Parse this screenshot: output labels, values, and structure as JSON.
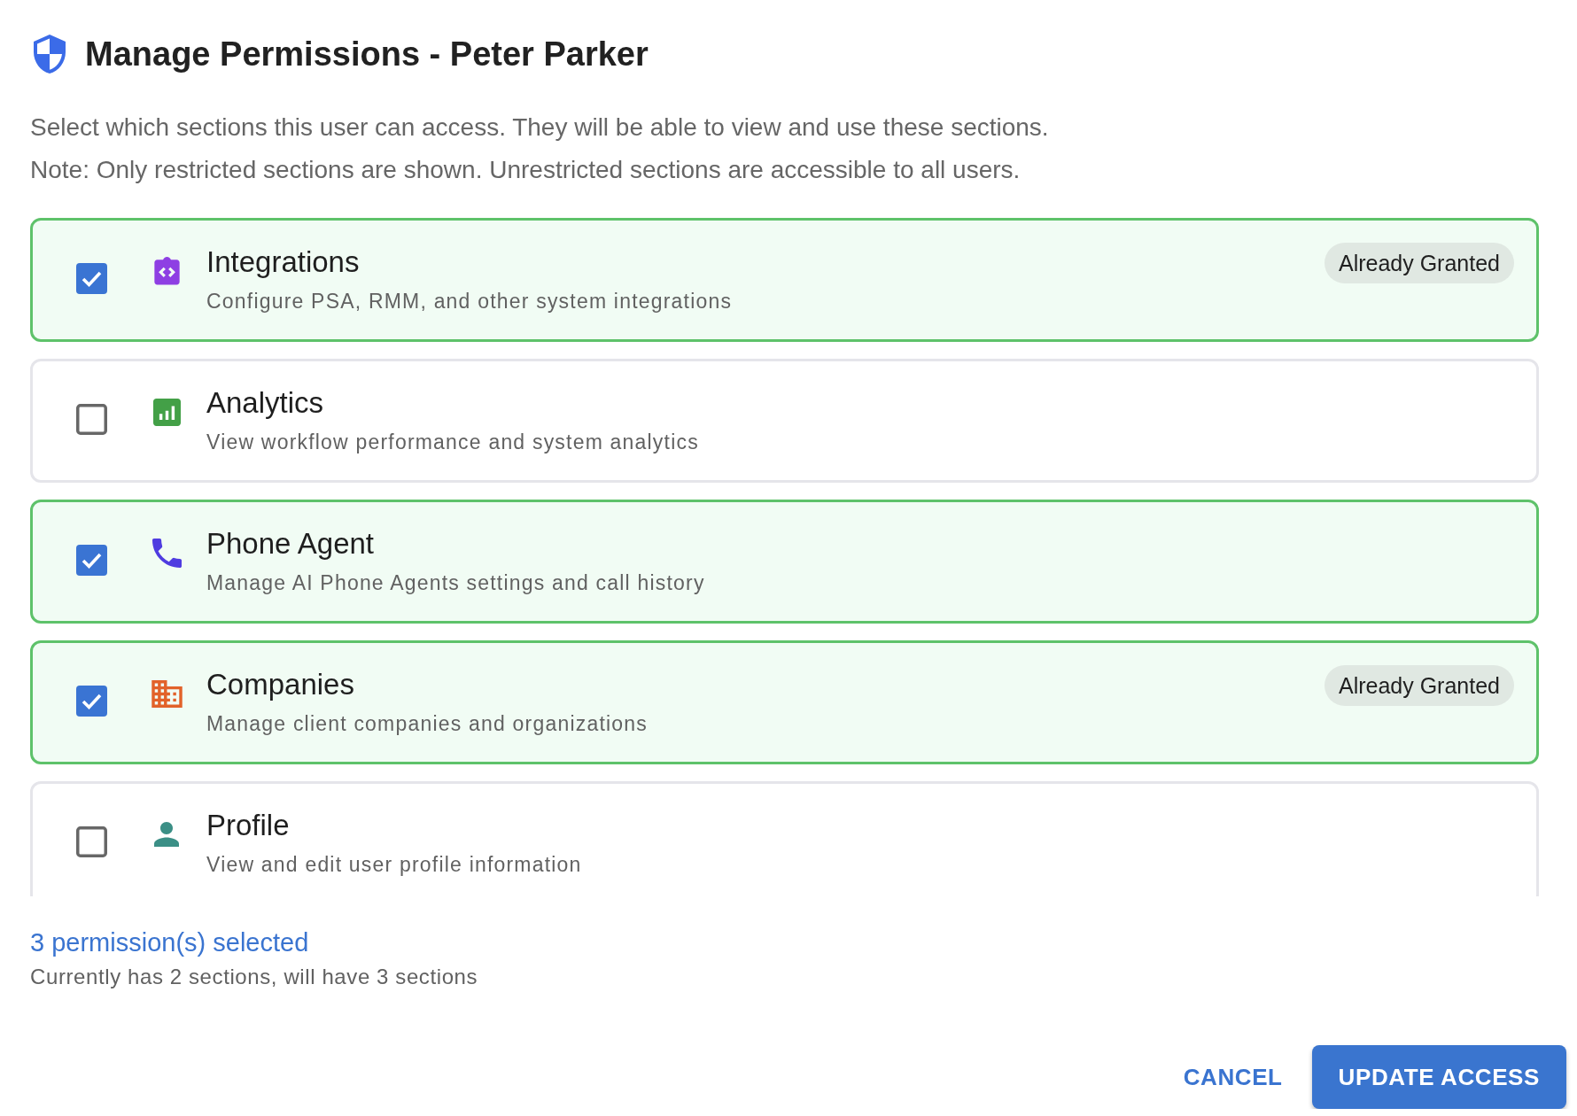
{
  "dialog": {
    "title": "Manage Permissions - Peter Parker",
    "description": [
      "Select which sections this user can access. They will be able to view and use these sections.",
      "Note: Only restricted sections are shown. Unrestricted sections are accessible to all users."
    ]
  },
  "sections": [
    {
      "name": "Integrations",
      "description": "Configure PSA, RMM, and other system integrations",
      "checked": true,
      "badge": "Already Granted",
      "color": "#8e3fe3"
    },
    {
      "name": "Analytics",
      "description": "View workflow performance and system analytics",
      "checked": false,
      "color": "#43a047"
    },
    {
      "name": "Phone Agent",
      "description": "Manage AI Phone Agents settings and call history",
      "checked": true,
      "color": "#4f3ce0"
    },
    {
      "name": "Companies",
      "description": "Manage client companies and organizations",
      "checked": true,
      "badge": "Already Granted",
      "color": "#e2622a"
    },
    {
      "name": "Profile",
      "description": "View and edit user profile information",
      "checked": false,
      "color": "#3b8f86"
    }
  ],
  "footer": {
    "selected_count": "3 permission(s) selected",
    "summary": "Currently has 2 sections, will have 3 sections"
  },
  "buttons": [
    {
      "label": "CANCEL",
      "kind": "text"
    },
    {
      "label": "UPDATE ACCESS",
      "kind": "contained"
    }
  ]
}
